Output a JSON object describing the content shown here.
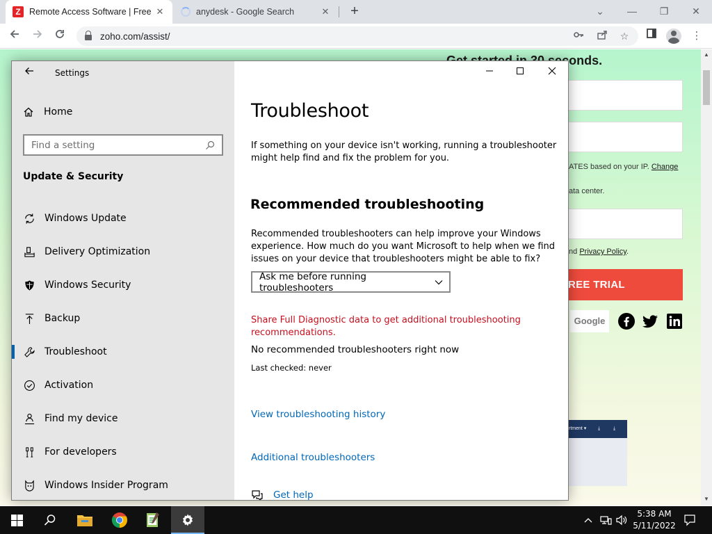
{
  "browser": {
    "tabs": [
      {
        "title": "Remote Access Software | Free R",
        "active": true
      },
      {
        "title": "anydesk - Google Search",
        "active": false
      }
    ],
    "url": "zoho.com/assist/"
  },
  "background_page": {
    "heading": "Get started in 30 seconds.",
    "location_text": "ATES based on your IP.",
    "location_link": "Change",
    "datacenter_text": "ata center.",
    "privacy_prefix": "nd",
    "privacy_link": "Privacy Policy",
    "privacy_suffix": ".",
    "trial_button": "REE TRIAL",
    "google_label": "Google",
    "preview_label": "rtment"
  },
  "settings": {
    "app_title": "Settings",
    "home_label": "Home",
    "search_placeholder": "Find a setting",
    "section_title": "Update & Security",
    "nav_items": [
      {
        "label": "Windows Update",
        "icon": "sync-icon"
      },
      {
        "label": "Delivery Optimization",
        "icon": "delivery-optimization-icon"
      },
      {
        "label": "Windows Security",
        "icon": "shield-icon"
      },
      {
        "label": "Backup",
        "icon": "backup-arrow-icon"
      },
      {
        "label": "Troubleshoot",
        "icon": "wrench-icon",
        "selected": true
      },
      {
        "label": "Activation",
        "icon": "check-circle-icon"
      },
      {
        "label": "Find my device",
        "icon": "person-location-icon"
      },
      {
        "label": "For developers",
        "icon": "developer-tools-icon"
      },
      {
        "label": "Windows Insider Program",
        "icon": "insider-cat-icon"
      }
    ],
    "content": {
      "title": "Troubleshoot",
      "intro": "If something on your device isn't working, running a troubleshooter might help find and fix the problem for you.",
      "recommended_heading": "Recommended troubleshooting",
      "recommended_desc": "Recommended troubleshooters can help improve your Windows experience. How much do you want Microsoft to help when we find issues on your device that troubleshooters might be able to fix?",
      "dropdown_value": "Ask me before running troubleshooters",
      "diagnostic_link": "Share Full Diagnostic data to get additional troubleshooting recommendations.",
      "status": "No recommended troubleshooters right now",
      "last_checked": "Last checked: never",
      "history_link": "View troubleshooting history",
      "additional_link": "Additional troubleshooters",
      "get_help": "Get help"
    }
  },
  "taskbar": {
    "time": "5:38 AM",
    "date": "5/11/2022"
  },
  "colors": {
    "accent_blue": "#0067b8",
    "selection_bar": "#0063b1",
    "diagnostic_red": "#c50f1f",
    "trial_red": "#ee4b3d"
  }
}
